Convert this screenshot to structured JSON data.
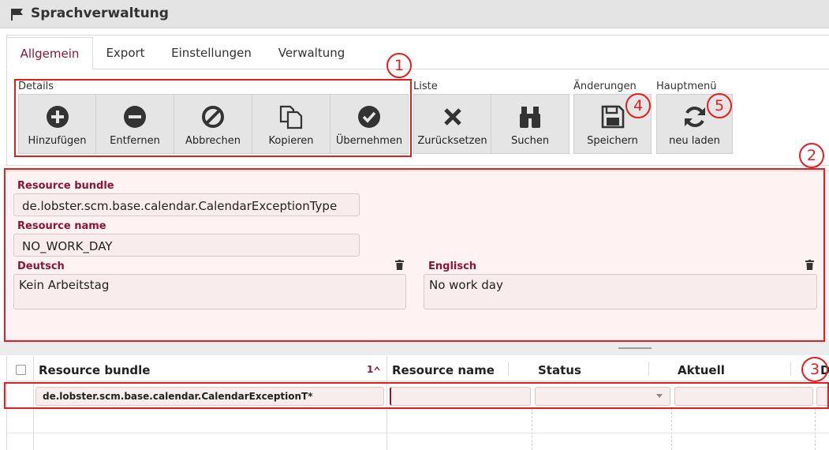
{
  "window": {
    "title": "Sprachverwaltung"
  },
  "tabs": [
    {
      "label": "Allgemein",
      "active": true
    },
    {
      "label": "Export"
    },
    {
      "label": "Einstellungen"
    },
    {
      "label": "Verwaltung"
    }
  ],
  "toolbar": {
    "groups": {
      "details": "Details",
      "liste": "Liste",
      "aenderungen": "Änderungen",
      "hauptmenue": "Hauptmenü"
    },
    "buttons": {
      "hinzufuegen": {
        "label": "Hinzufügen",
        "icon": "plus-circle-icon"
      },
      "entfernen": {
        "label": "Entfernen",
        "icon": "minus-circle-icon"
      },
      "abbrechen": {
        "label": "Abbrechen",
        "icon": "ban-icon"
      },
      "kopieren": {
        "label": "Kopieren",
        "icon": "copy-icon"
      },
      "uebernehmen": {
        "label": "Übernehmen",
        "icon": "check-circle-icon"
      },
      "zuruecksetzen": {
        "label": "Zurücksetzen",
        "icon": "x-icon"
      },
      "suchen": {
        "label": "Suchen",
        "icon": "binoculars-icon"
      },
      "speichern": {
        "label": "Speichern",
        "icon": "save-icon"
      },
      "neu_laden": {
        "label": "neu laden",
        "icon": "refresh-icon"
      }
    }
  },
  "callouts": [
    "1",
    "2",
    "3",
    "4",
    "5"
  ],
  "form": {
    "resource_bundle": {
      "label": "Resource bundle",
      "value": "de.lobster.scm.base.calendar.CalendarExceptionType"
    },
    "resource_name": {
      "label": "Resource name",
      "value": "NO_WORK_DAY"
    },
    "deutsch": {
      "label": "Deutsch",
      "value": "Kein Arbeitstag"
    },
    "englisch": {
      "label": "Englisch",
      "value": "No work day"
    }
  },
  "grid": {
    "columns": {
      "resource_bundle": "Resource bundle",
      "sort_index": "1",
      "resource_name": "Resource name",
      "status": "Status",
      "aktuell": "Aktuell",
      "cut": "D"
    },
    "rows": [
      {
        "resource_bundle": "de.lobster.scm.base.calendar.CalendarExceptionT*",
        "resource_name": "",
        "status": "",
        "aktuell": ""
      }
    ]
  },
  "colors": {
    "accent": "#8a1538",
    "annotation": "#e41e1e",
    "form_bg": "#fff2f2"
  }
}
